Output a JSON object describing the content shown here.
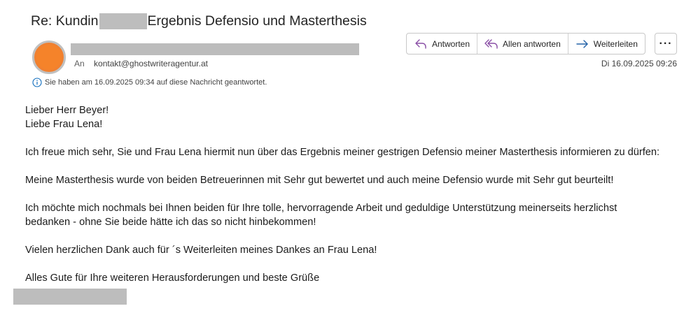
{
  "subject": {
    "prefix": "Re: Kundin",
    "suffix": "Ergebnis Defensio und Masterthesis"
  },
  "sender": {
    "to_label": "An",
    "to_address": "kontakt@ghostwriteragentur.at",
    "avatar_color": "#f5832a"
  },
  "actions": {
    "reply_label": "Antworten",
    "reply_all_label": "Allen antworten",
    "forward_label": "Weiterleiten",
    "more_label": "···",
    "accent_color": "#8a4fa6",
    "forward_color": "#2563a8"
  },
  "date": "Di 16.09.2025 09:26",
  "info": {
    "text": "Sie haben am 16.09.2025 09:34 auf diese Nachricht geantwortet."
  },
  "body": {
    "line1": "Lieber Herr Beyer!",
    "line2": "Liebe Frau Lena!",
    "para1": "Ich freue mich sehr, Sie und Frau Lena hiermit nun über das Ergebnis meiner gestrigen Defensio meiner Masterthesis informieren zu dürfen:",
    "para2": "Meine Masterthesis wurde von beiden Betreuerinnen mit Sehr gut bewertet und auch meine Defensio wurde mit Sehr gut beurteilt!",
    "para3a": "Ich möchte mich nochmals bei Ihnen beiden für Ihre tolle, hervorragende Arbeit und geduldige Unterstützung meinerseits herzlichst",
    "para3b": "bedanken - ohne Sie beide hätte ich das so nicht hinbekommen!",
    "para4": "Vielen herzlichen Dank auch für ´s Weiterleiten meines Dankes an Frau Lena!",
    "para5": "Alles Gute für Ihre weiteren Herausforderungen und beste Grüße"
  }
}
